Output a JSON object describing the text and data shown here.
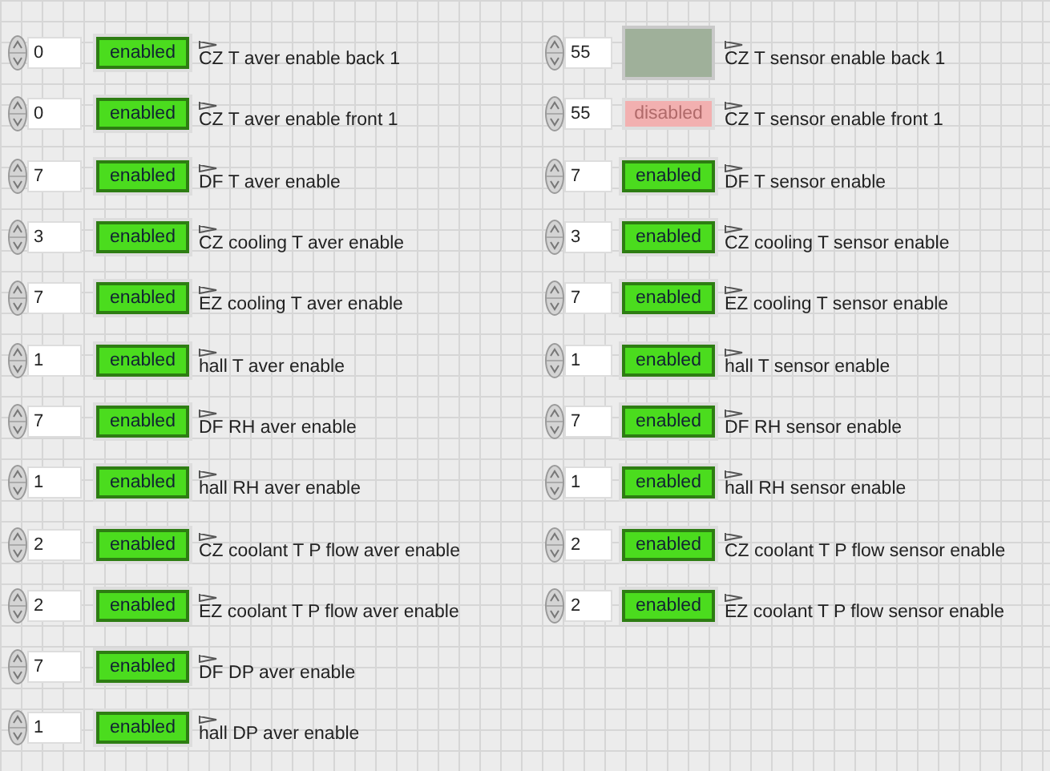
{
  "columns": [
    {
      "rows": [
        {
          "value": "0",
          "kind": "labeled",
          "on": true,
          "indicator_text": "enabled",
          "label": "CZ T aver enable back 1"
        },
        {
          "value": "0",
          "kind": "labeled",
          "on": true,
          "indicator_text": "enabled",
          "label": "CZ T aver enable front 1"
        },
        {
          "value": "7",
          "kind": "labeled",
          "on": true,
          "indicator_text": "enabled",
          "label": "DF T aver enable"
        },
        {
          "value": "3",
          "kind": "labeled",
          "on": true,
          "indicator_text": "enabled",
          "label": "CZ cooling T aver enable"
        },
        {
          "value": "7",
          "kind": "labeled",
          "on": true,
          "indicator_text": "enabled",
          "label": "EZ cooling T aver enable"
        },
        {
          "value": "1",
          "kind": "labeled",
          "on": true,
          "indicator_text": "enabled",
          "label": "hall T aver enable"
        },
        {
          "value": "7",
          "kind": "labeled",
          "on": true,
          "indicator_text": "enabled",
          "label": "DF RH aver enable"
        },
        {
          "value": "1",
          "kind": "labeled",
          "on": true,
          "indicator_text": "enabled",
          "label": "hall RH aver enable"
        },
        {
          "value": "2",
          "kind": "labeled",
          "on": true,
          "indicator_text": "enabled",
          "label": "CZ coolant T P flow aver enable"
        },
        {
          "value": "2",
          "kind": "labeled",
          "on": true,
          "indicator_text": "enabled",
          "label": "EZ coolant T P flow aver enable"
        },
        {
          "value": "7",
          "kind": "labeled",
          "on": true,
          "indicator_text": "enabled",
          "label": "DF DP aver enable"
        },
        {
          "value": "1",
          "kind": "labeled",
          "on": true,
          "indicator_text": "enabled",
          "label": "hall DP aver enable"
        }
      ]
    },
    {
      "rows": [
        {
          "value": "55",
          "kind": "blank",
          "label": "CZ T sensor enable back 1"
        },
        {
          "value": "55",
          "kind": "labeled",
          "on": false,
          "indicator_text": "disabled",
          "label": "CZ T sensor enable front 1"
        },
        {
          "value": "7",
          "kind": "labeled",
          "on": true,
          "indicator_text": "enabled",
          "label": "DF T sensor enable"
        },
        {
          "value": "3",
          "kind": "labeled",
          "on": true,
          "indicator_text": "enabled",
          "label": "CZ cooling T sensor enable"
        },
        {
          "value": "7",
          "kind": "labeled",
          "on": true,
          "indicator_text": "enabled",
          "label": "EZ cooling T sensor enable"
        },
        {
          "value": "1",
          "kind": "labeled",
          "on": true,
          "indicator_text": "enabled",
          "label": "hall T sensor enable"
        },
        {
          "value": "7",
          "kind": "labeled",
          "on": true,
          "indicator_text": "enabled",
          "label": "DF RH sensor enable"
        },
        {
          "value": "1",
          "kind": "labeled",
          "on": true,
          "indicator_text": "enabled",
          "label": "hall RH sensor enable"
        },
        {
          "value": "2",
          "kind": "labeled",
          "on": true,
          "indicator_text": "enabled",
          "label": "CZ coolant T P flow sensor enable"
        },
        {
          "value": "2",
          "kind": "labeled",
          "on": true,
          "indicator_text": "enabled",
          "label": "EZ coolant T P flow sensor enable"
        }
      ]
    }
  ]
}
